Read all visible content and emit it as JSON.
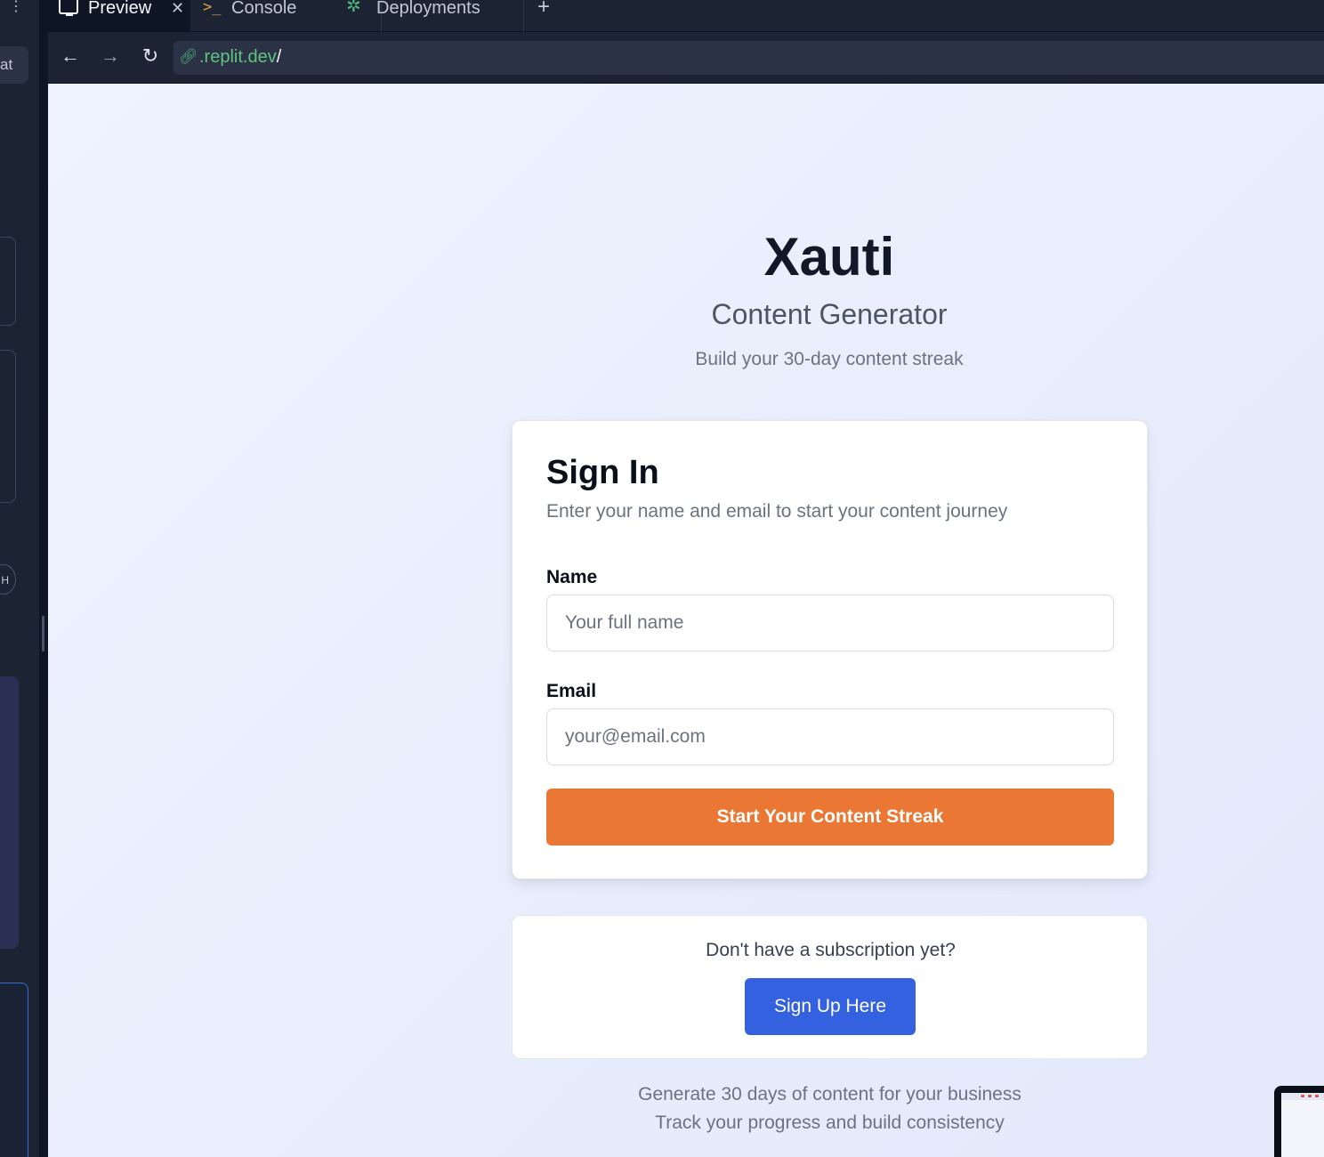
{
  "ide": {
    "tabs": {
      "preview": "Preview",
      "console": "Console",
      "deployments": "Deployments"
    },
    "sidebar": {
      "chat_chip": "at",
      "avatar_initial": "H"
    },
    "address_bar": {
      "url": ".replit.dev",
      "url_suffix": "/"
    },
    "icons": {
      "tab_preview": "monitor-icon",
      "tab_console": "terminal-prompt-icon",
      "tab_deployments": "deploy-tree-icon",
      "close": "close-icon",
      "add_tab": "plus-icon",
      "back": "arrow-left-icon",
      "forward": "arrow-right-icon",
      "reload": "reload-icon",
      "url": "link-icon"
    }
  },
  "page": {
    "brand": {
      "title": "Xauti",
      "subtitle": "Content Generator",
      "tagline": "Build your 30-day content streak"
    },
    "signin": {
      "title": "Sign In",
      "description": "Enter your name and email to start your content journey",
      "name_label": "Name",
      "name_placeholder": "Your full name",
      "email_label": "Email",
      "email_placeholder": "your@email.com",
      "submit_label": "Start Your Content Streak"
    },
    "signup": {
      "question": "Don't have a subscription yet?",
      "button_label": "Sign Up Here"
    },
    "footer": {
      "line1": "Generate 30 days of content for your business",
      "line2": "Track your progress and build consistency"
    }
  },
  "colors": {
    "accent_orange": "#ea7834",
    "accent_blue": "#3461e0",
    "ide_bg": "#1c2333",
    "url_green": "#5fc47f"
  }
}
